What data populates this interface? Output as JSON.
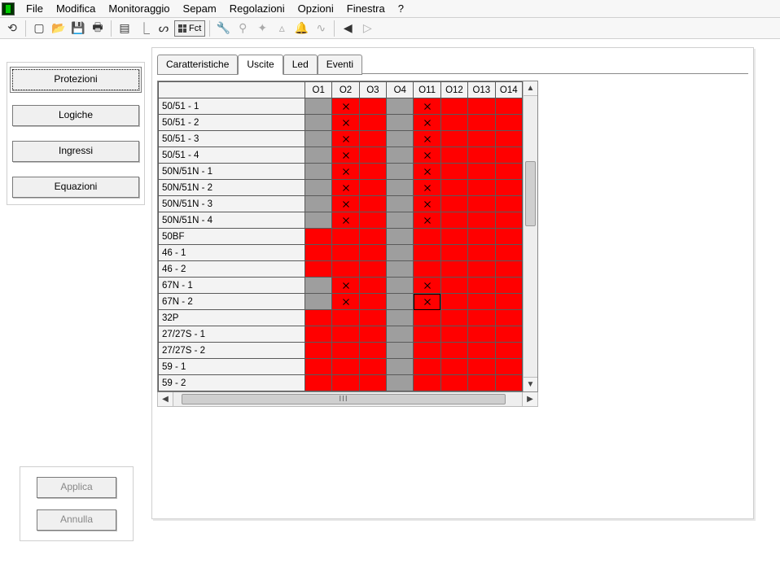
{
  "menubar": {
    "items": [
      "File",
      "Modifica",
      "Monitoraggio",
      "Sepam",
      "Regolazioni",
      "Opzioni",
      "Finestra",
      "?"
    ]
  },
  "fct_label": "Fct",
  "sidebar": {
    "buttons": [
      {
        "label": "Protezioni",
        "active": true
      },
      {
        "label": "Logiche",
        "active": false
      },
      {
        "label": "Ingressi",
        "active": false
      },
      {
        "label": "Equazioni",
        "active": false
      }
    ]
  },
  "actions": {
    "apply": "Applica",
    "cancel": "Annulla"
  },
  "tabs": [
    {
      "label": "Caratteristiche",
      "active": false
    },
    {
      "label": "Uscite",
      "active": true
    },
    {
      "label": "Led",
      "active": false
    },
    {
      "label": "Eventi",
      "active": false
    }
  ],
  "grid": {
    "columns": [
      "O1",
      "O2",
      "O3",
      "O4",
      "O11",
      "O12",
      "O13",
      "O14"
    ],
    "rows": [
      {
        "label": "50/51 - 1",
        "cells": [
          "grey",
          "x",
          "red",
          "grey",
          "x",
          "red",
          "red",
          "red"
        ]
      },
      {
        "label": "50/51 - 2",
        "cells": [
          "grey",
          "x",
          "red",
          "grey",
          "x",
          "red",
          "red",
          "red"
        ]
      },
      {
        "label": "50/51 - 3",
        "cells": [
          "grey",
          "x",
          "red",
          "grey",
          "x",
          "red",
          "red",
          "red"
        ]
      },
      {
        "label": "50/51 - 4",
        "cells": [
          "grey",
          "x",
          "red",
          "grey",
          "x",
          "red",
          "red",
          "red"
        ]
      },
      {
        "label": "50N/51N - 1",
        "cells": [
          "grey",
          "x",
          "red",
          "grey",
          "x",
          "red",
          "red",
          "red"
        ]
      },
      {
        "label": "50N/51N - 2",
        "cells": [
          "grey",
          "x",
          "red",
          "grey",
          "x",
          "red",
          "red",
          "red"
        ]
      },
      {
        "label": "50N/51N - 3",
        "cells": [
          "grey",
          "x",
          "red",
          "grey",
          "x",
          "red",
          "red",
          "red"
        ]
      },
      {
        "label": "50N/51N - 4",
        "cells": [
          "grey",
          "x",
          "red",
          "grey",
          "x",
          "red",
          "red",
          "red"
        ]
      },
      {
        "label": "50BF",
        "cells": [
          "red",
          "red",
          "red",
          "grey",
          "red",
          "red",
          "red",
          "red"
        ]
      },
      {
        "label": "46 - 1",
        "cells": [
          "red",
          "red",
          "red",
          "grey",
          "red",
          "red",
          "red",
          "red"
        ]
      },
      {
        "label": "46 - 2",
        "cells": [
          "red",
          "red",
          "red",
          "grey",
          "red",
          "red",
          "red",
          "red"
        ]
      },
      {
        "label": "67N - 1",
        "cells": [
          "grey",
          "x",
          "red",
          "grey",
          "x",
          "red",
          "red",
          "red"
        ]
      },
      {
        "label": "67N - 2",
        "cells": [
          "grey",
          "x",
          "red",
          "grey",
          "xsel",
          "red",
          "red",
          "red"
        ]
      },
      {
        "label": "32P",
        "cells": [
          "red",
          "red",
          "red",
          "grey",
          "red",
          "red",
          "red",
          "red"
        ]
      },
      {
        "label": "27/27S - 1",
        "cells": [
          "red",
          "red",
          "red",
          "grey",
          "red",
          "red",
          "red",
          "red"
        ]
      },
      {
        "label": "27/27S - 2",
        "cells": [
          "red",
          "red",
          "red",
          "grey",
          "red",
          "red",
          "red",
          "red"
        ]
      },
      {
        "label": "59 - 1",
        "cells": [
          "red",
          "red",
          "red",
          "grey",
          "red",
          "red",
          "red",
          "red"
        ]
      },
      {
        "label": "59 - 2",
        "cells": [
          "red",
          "red",
          "red",
          "grey",
          "red",
          "red",
          "red",
          "red"
        ]
      }
    ]
  }
}
